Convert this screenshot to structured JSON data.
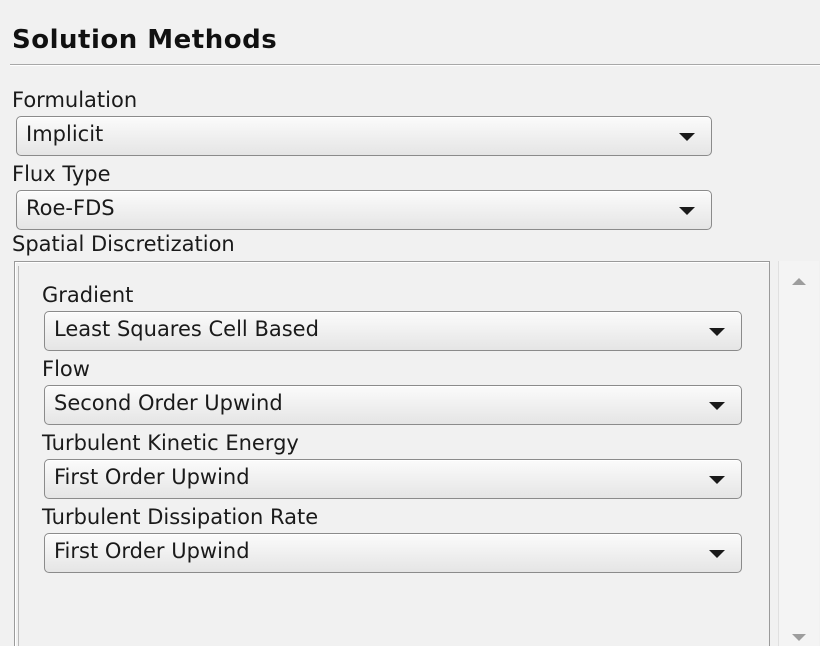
{
  "panel": {
    "title": "Solution Methods"
  },
  "formulation": {
    "label": "Formulation",
    "value": "Implicit"
  },
  "flux_type": {
    "label": "Flux Type",
    "value": "Roe-FDS"
  },
  "spatial_discretization": {
    "label": "Spatial Discretization",
    "gradient": {
      "label": "Gradient",
      "value": "Least Squares Cell Based"
    },
    "flow": {
      "label": "Flow",
      "value": "Second Order Upwind"
    },
    "turbulent_kinetic_energy": {
      "label": "Turbulent Kinetic Energy",
      "value": "First Order Upwind"
    },
    "turbulent_dissipation_rate": {
      "label": "Turbulent Dissipation Rate",
      "value": "First Order Upwind"
    }
  },
  "icons": {
    "dropdown": "chevron-down-icon",
    "scroll_up": "scroll-up-arrow-icon",
    "scroll_down": "scroll-down-arrow-icon"
  }
}
